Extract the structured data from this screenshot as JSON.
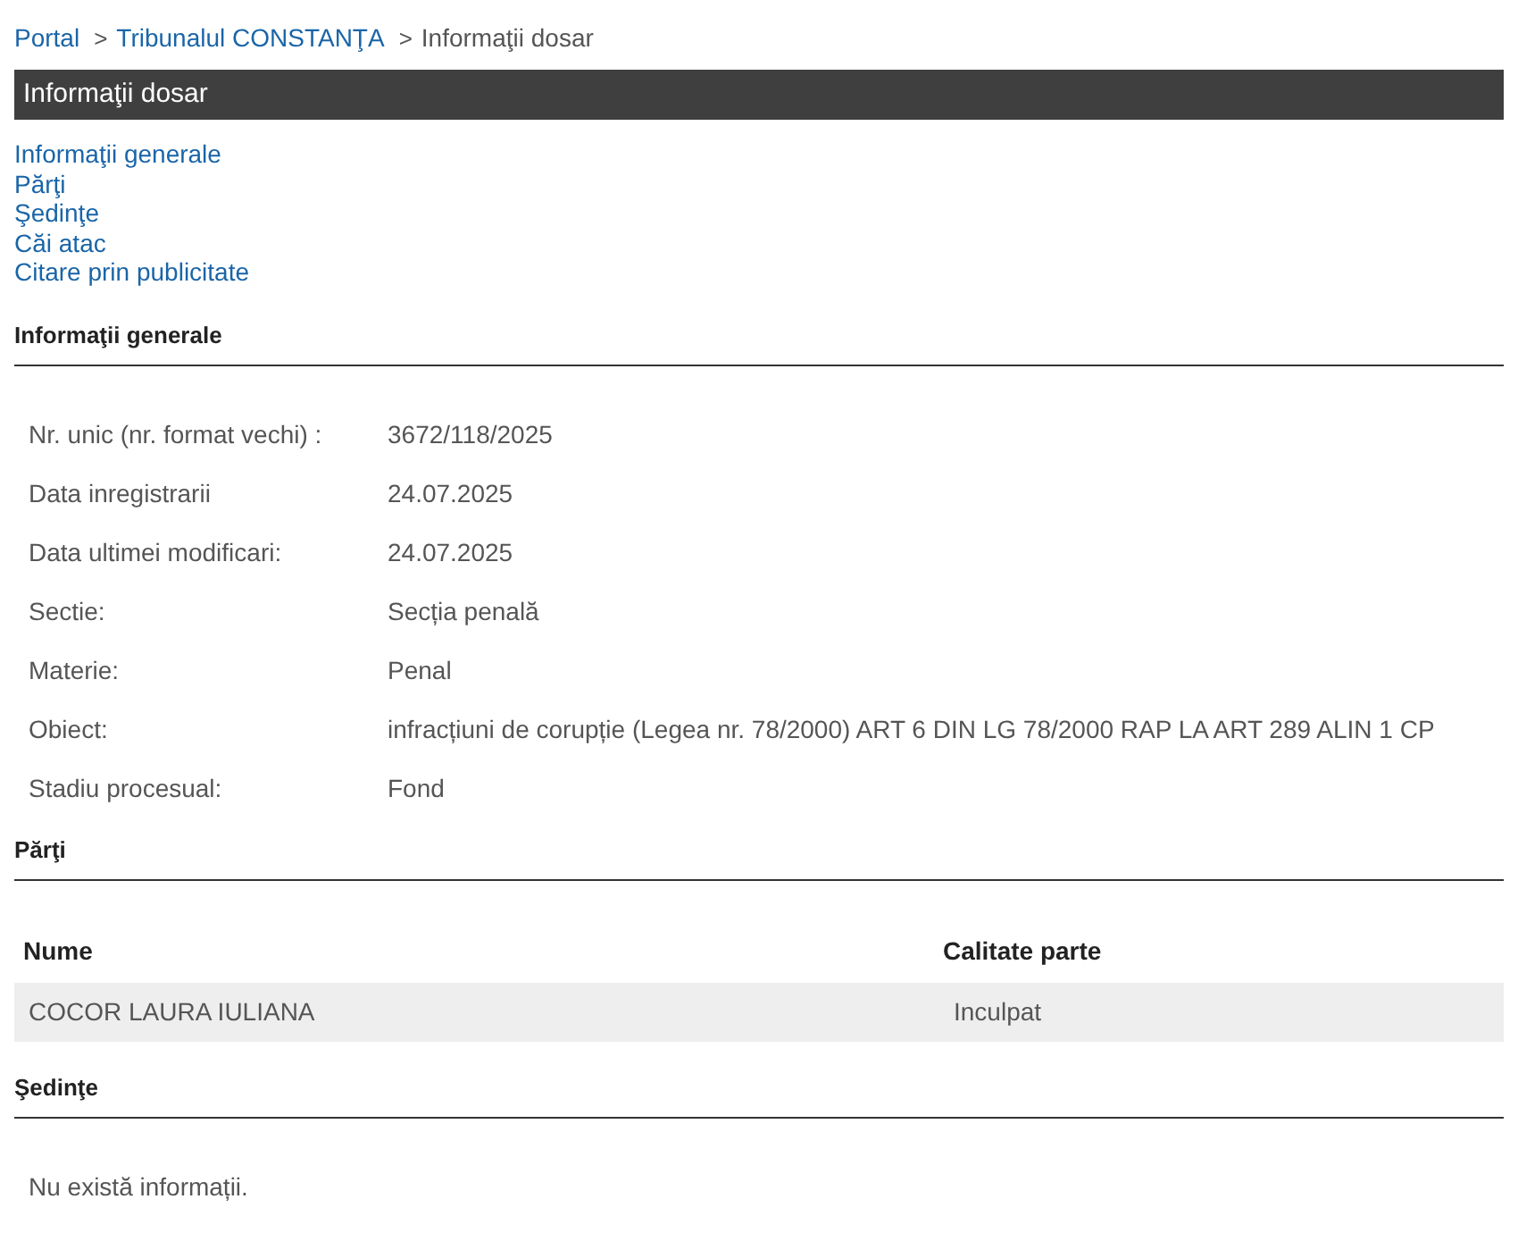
{
  "breadcrumb": [
    {
      "kind": "link",
      "text": "Portal"
    },
    {
      "kind": "separator",
      "text": ">"
    },
    {
      "kind": "link",
      "text": "Tribunalul CONSTANŢA"
    },
    {
      "kind": "separator",
      "text": ">"
    },
    {
      "kind": "current",
      "text": "Informaţii dosar"
    }
  ],
  "title_bar": "Informaţii dosar",
  "nav_links": [
    "Informaţii generale",
    "Părţi",
    "Şedinţe",
    "Căi atac",
    "Citare prin publicitate"
  ],
  "general": {
    "heading": "Informaţii generale",
    "fields": [
      {
        "label": "Nr. unic (nr. format vechi) :",
        "value": "3672/118/2025"
      },
      {
        "label": "Data inregistrarii",
        "value": "24.07.2025"
      },
      {
        "label": "Data ultimei modificari:",
        "value": "24.07.2025"
      },
      {
        "label": "Sectie:",
        "value": "Secția penală"
      },
      {
        "label": "Materie:",
        "value": "Penal"
      },
      {
        "label": "Obiect:",
        "value": "infracțiuni de corupție (Legea nr. 78/2000) ART 6 DIN LG 78/2000 RAP LA ART 289 ALIN 1 CP"
      },
      {
        "label": "Stadiu procesual:",
        "value": "Fond"
      }
    ]
  },
  "parties": {
    "heading": "Părţi",
    "columns": [
      "Nume",
      "Calitate parte"
    ],
    "rows": [
      [
        "COCOR LAURA IULIANA",
        "Inculpat"
      ]
    ]
  },
  "hearings": {
    "heading": "Şedinţe",
    "message": "Nu există informații."
  }
}
